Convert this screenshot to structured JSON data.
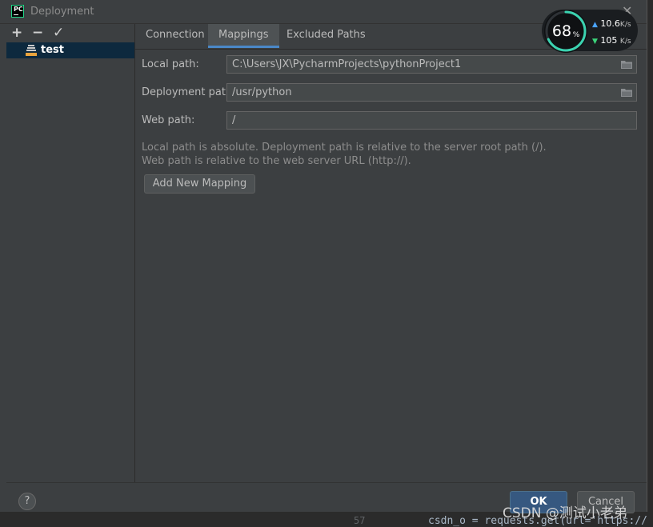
{
  "window": {
    "title": "Deployment",
    "app_icon_text": "PC"
  },
  "left_panel": {
    "toolbar": {
      "add": "+",
      "remove": "−",
      "apply": "✓"
    },
    "servers": [
      {
        "label": "test",
        "icon": "sftp-server-icon"
      }
    ]
  },
  "tabs": [
    {
      "label": "Connection",
      "active": false
    },
    {
      "label": "Mappings",
      "active": true
    },
    {
      "label": "Excluded Paths",
      "active": false
    }
  ],
  "form": {
    "local_path": {
      "label": "Local path:",
      "value": "C:\\Users\\JX\\PycharmProjects\\pythonProject1"
    },
    "deployment_path": {
      "label": "Deployment path:",
      "value": "/usr/python"
    },
    "web_path": {
      "label": "Web path:",
      "value": "/"
    },
    "hint_line1": "Local path is absolute. Deployment path is relative to the server root path (/).",
    "hint_line2": "Web path is relative to the web server URL (http://).",
    "add_mapping_label": "Add New Mapping"
  },
  "footer": {
    "help_label": "?",
    "ok_label": "OK",
    "cancel_label": "Cancel"
  },
  "speed_widget": {
    "percent": "68",
    "percent_unit": "%",
    "percent_value": 0.68,
    "upload": "10.6",
    "download": "105",
    "unit": "K/s"
  },
  "background": {
    "code_line": "csdn_o = requests.get(url='https://",
    "line_number": "57"
  },
  "watermark": "CSDN @测试小老弟",
  "colors": {
    "accent": "#4a88c7",
    "selection": "#0d293e",
    "ok_button": "#365880",
    "gauge_ring": "#3bd3b0"
  }
}
